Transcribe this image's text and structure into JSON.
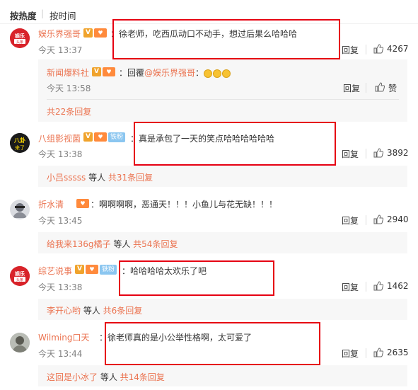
{
  "sort": {
    "hot": "按热度",
    "separator": "|",
    "time": "按时间"
  },
  "comments": [
    {
      "user": "娱乐界强哥",
      "avatar_text": "娱乐头条",
      "text": "徐老师，吃西瓜动口不动手，想过后果么哈哈哈",
      "time": "今天 13:37",
      "reply_label": "回复",
      "likes": "4267",
      "sub": {
        "user": "新闻爆料社",
        "reply_prefix": "：回覆",
        "reply_target": "@娱乐界强哥",
        "reply_suffix": "：",
        "time": "今天 13:58",
        "reply_label": "回复",
        "like_label": "赞"
      },
      "more": "共22条回复"
    },
    {
      "user": "八组影视菌",
      "avatar_text": "八卦来了",
      "fan_badge": "铁粉",
      "text": "真是承包了一天的笑点哈哈哈哈哈哈",
      "time": "今天 13:38",
      "reply_label": "回复",
      "likes": "3892",
      "more_user": "小吕sssss",
      "more_mid": " 等人 ",
      "more_count": "共31条回复"
    },
    {
      "user": "折水清",
      "text": "：啊啊啊啊，恶通天！！！小鱼儿与花无缺！！！",
      "time": "今天 13:45",
      "reply_label": "回复",
      "likes": "2940",
      "more_user": "给我来136g橘子",
      "more_mid": " 等人 ",
      "more_count": "共54条回复"
    },
    {
      "user": "综艺说事",
      "avatar_text": "娱乐头条",
      "fan_badge": "铁粉",
      "text": "哈哈哈哈太欢乐了吧",
      "time": "今天 13:38",
      "reply_label": "回复",
      "likes": "1462",
      "more_user": "李开心哟",
      "more_mid": " 等人 ",
      "more_count": "共6条回复"
    },
    {
      "user": "Wilming口天",
      "text": "徐老师真的是小公举性格啊，太可爱了",
      "time": "今天 13:44",
      "reply_label": "回复",
      "likes": "2635",
      "more_user": "这回是小冰了",
      "more_mid": " 等人 ",
      "more_count": "共14条回复"
    }
  ],
  "colors": {
    "accent": "#eb7350",
    "highlight_box": "#e60012",
    "sub_bg": "#f7f7f7"
  }
}
